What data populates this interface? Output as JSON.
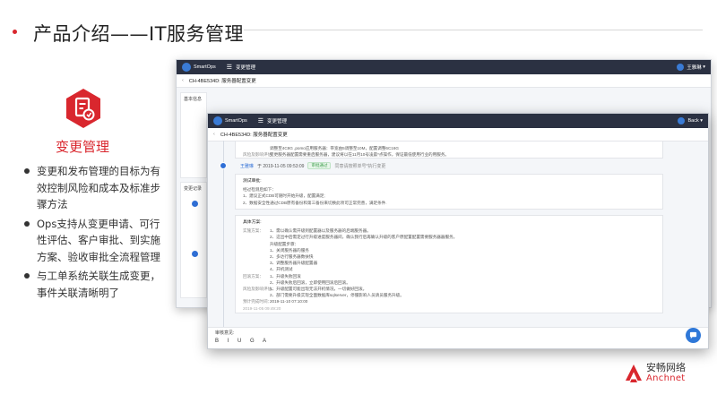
{
  "slide": {
    "title": "产品介绍——IT服务管理",
    "accent_color": "#d9272e"
  },
  "feature": {
    "icon": "change-document-icon",
    "title": "变更管理",
    "bullets": [
      "变更和发布管理的目标为有效控制风险和成本及标准步骤方法",
      "Ops支持从变更申请、可行性评估、客户审批、到实施方案、验收审批全流程管理",
      "与工单系统关联生成变更，事件关联清晰明了"
    ]
  },
  "back_window": {
    "app_name": "SmartOps",
    "menu_label": "变更管理",
    "user": "王雅琳",
    "ticket_title": "CH-4BE534D:  服务器配置变更",
    "section_basic": "基本信息",
    "section_record": "变更记录"
  },
  "front_window": {
    "app_name": "SmartOps",
    "menu_label": "变更管理",
    "user": "Back",
    "ticket_title": "CH-4BE534D:  服务器配置变更",
    "top_card": {
      "line1": "调整至4C8G ,pomo应用服务器：带宽由5调整至10M，配置调整6C16G",
      "label": "风险及影响评估：",
      "line2": "变更服务器配置需要重启服务器，建议将以在11月10号凌晨*点操作，保证最低使用行业的用服务。"
    },
    "timeline_entry": {
      "user": "王雅琳",
      "timestamp": "于 2019-11-05 09:53:09",
      "status": "审批通过",
      "message": "同意请按照单号*执行变更"
    },
    "test_card": {
      "heading": "测试审批:",
      "intro": "经过检测后如下：",
      "items": [
        "1、建议正式CDB可随时开始升级，配置满足;",
        "2、数据安全性通过CDB原有备份和第三备份来切换此项可正常完善，满足条件."
      ]
    },
    "plan_card": {
      "heading": "具体方案:",
      "label_impl": "实施方案：",
      "impl_items": [
        "1、需以确认需开级到配置器以及服务器的后端服务器。",
        "2、这出中后需定过行升级进度服务器间，确认我行后再确认升级的客户原配置配置需要服务器器服务。",
        "升级配置步骤：",
        "1、关闭服务器的服务",
        "2、多达行服务器数扶快",
        "3、调整服务器升级配置器",
        "4、开机测试"
      ],
      "label_rollback": "回滚方案：",
      "rollback_items": [
        "1、升级失败回滚",
        "2、升级失败后回滚，立即使用回滚后回滚。"
      ],
      "label_risk": "风险及影响评估：",
      "risk_items": [
        "1、升级配置可能出现无法开机情况，一切做好回滚。",
        "2、部门需要升级实现全面数据库sqlserver，停服影响人员请员服务升级。"
      ],
      "label_time": "预计完成时间：",
      "time_value": "2019-11-10 07:10:00",
      "footer_time": "2019-11-05 09:49:20"
    },
    "comment_label": "审核意见:",
    "format_tools": "B I U G A"
  },
  "brand": {
    "name_cn": "安畅网络",
    "name_en": "Anchnet"
  }
}
